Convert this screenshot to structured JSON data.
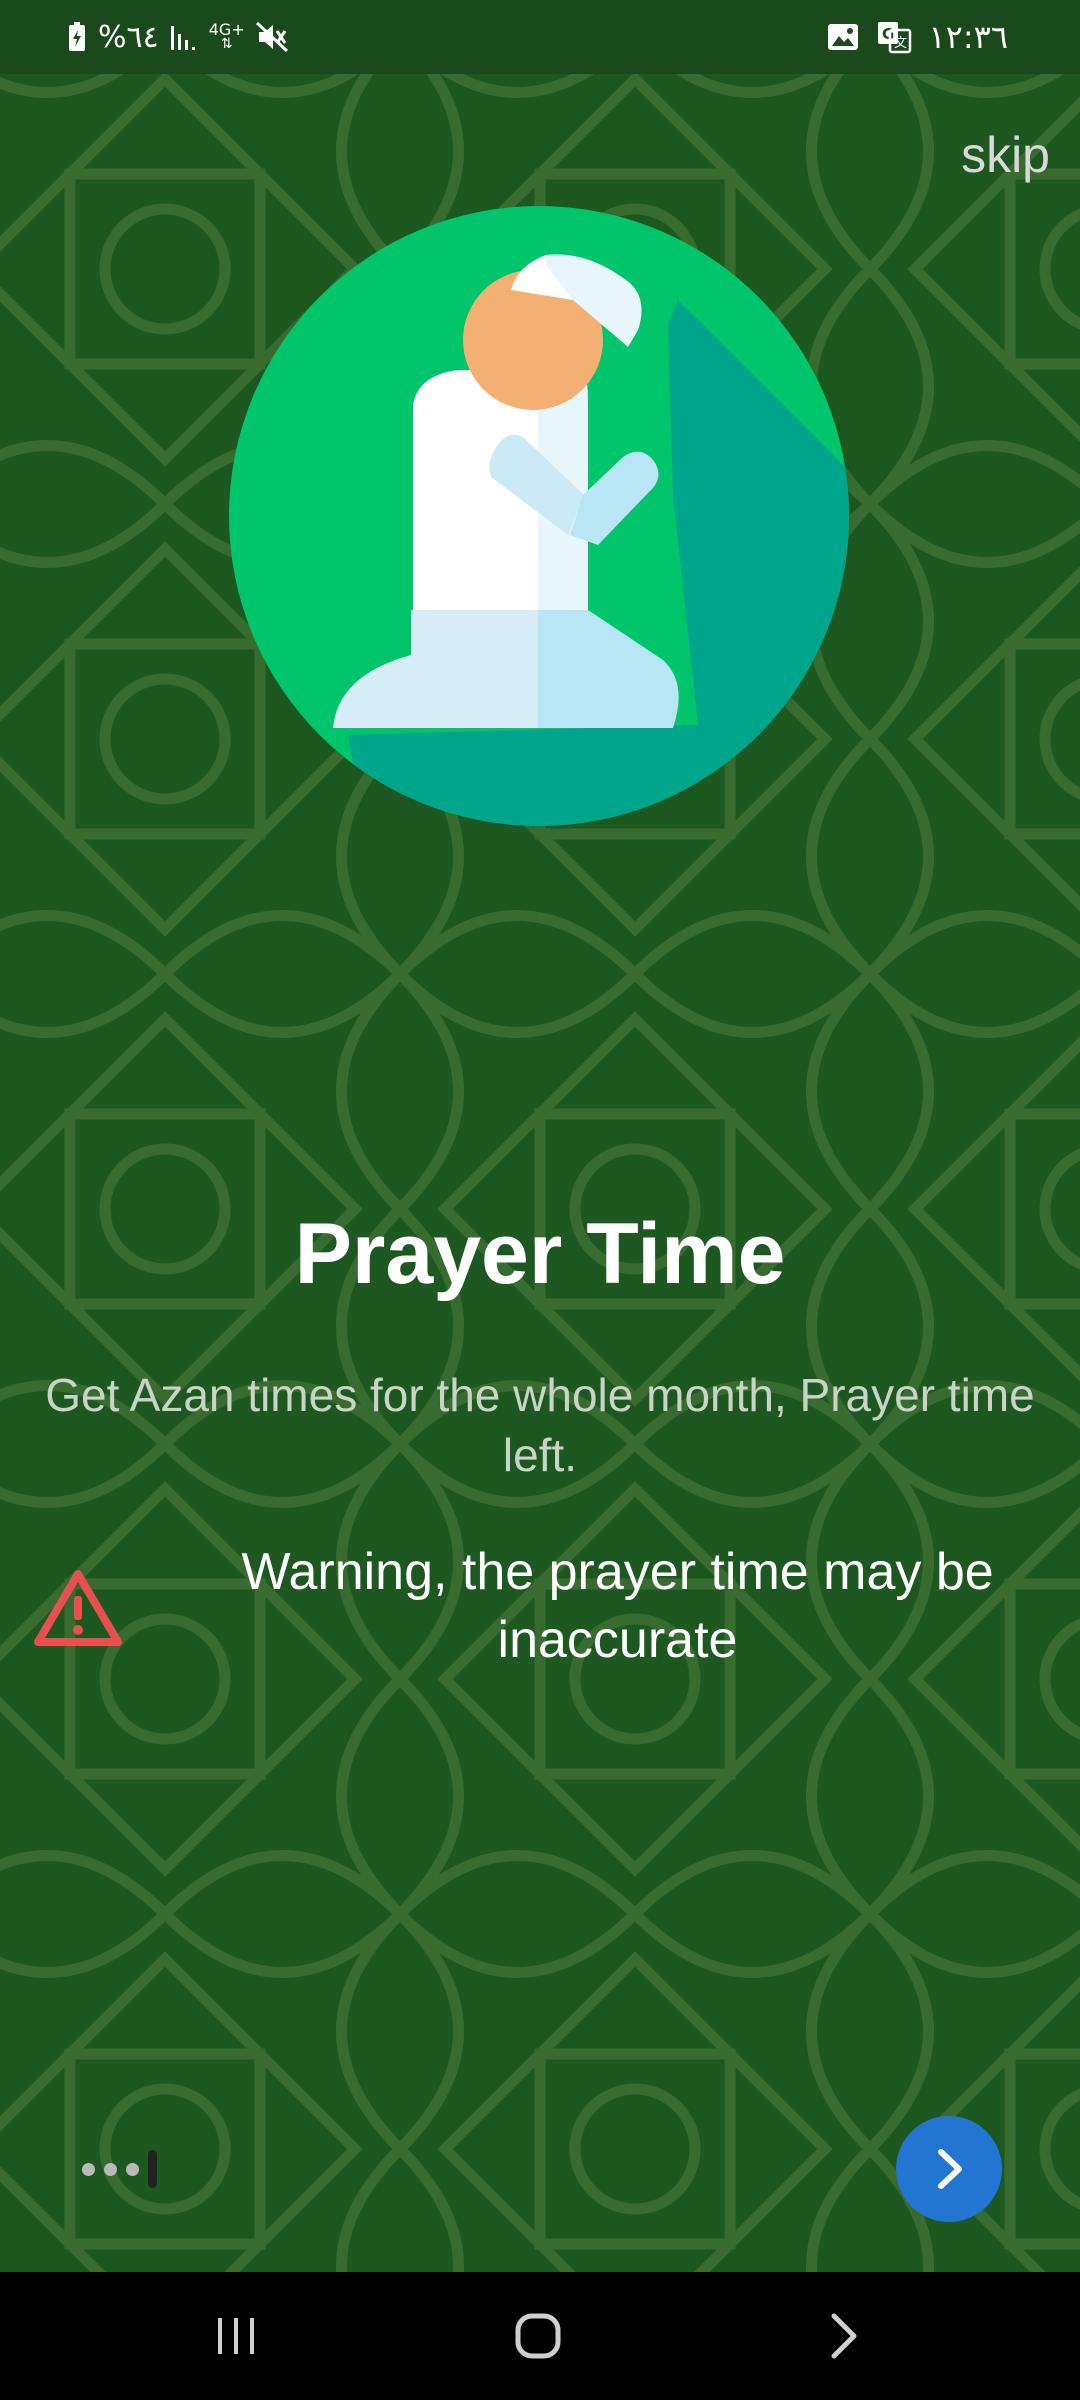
{
  "status_bar": {
    "battery_text": "%٦٤",
    "network_text": "4G+",
    "time": "١٢:٣٦",
    "icons": [
      "battery-charging-icon",
      "signal-icon",
      "network-4g-icon",
      "mute-icon",
      "image-notification-icon",
      "translate-notification-icon"
    ]
  },
  "onboarding": {
    "skip_label": "skip",
    "title": "Prayer Time",
    "subtitle": "Get Azan times for the whole month, Prayer time left.",
    "warning_text": "Warning, the prayer time may be inaccurate",
    "hero_icon": "praying-man-illustration",
    "page_indicator": {
      "total": 4,
      "current": 4
    },
    "next_icon": "chevron-right-icon"
  },
  "nav_bar": {
    "items": [
      "recent-apps-icon",
      "home-icon",
      "back-icon"
    ]
  },
  "colors": {
    "background": "#1d5820",
    "status_bar": "#1a4a1c",
    "circle_green": "#00c56b",
    "circle_shadow": "#00a68b",
    "warning": "#e85050",
    "next_button": "#2375d2"
  }
}
